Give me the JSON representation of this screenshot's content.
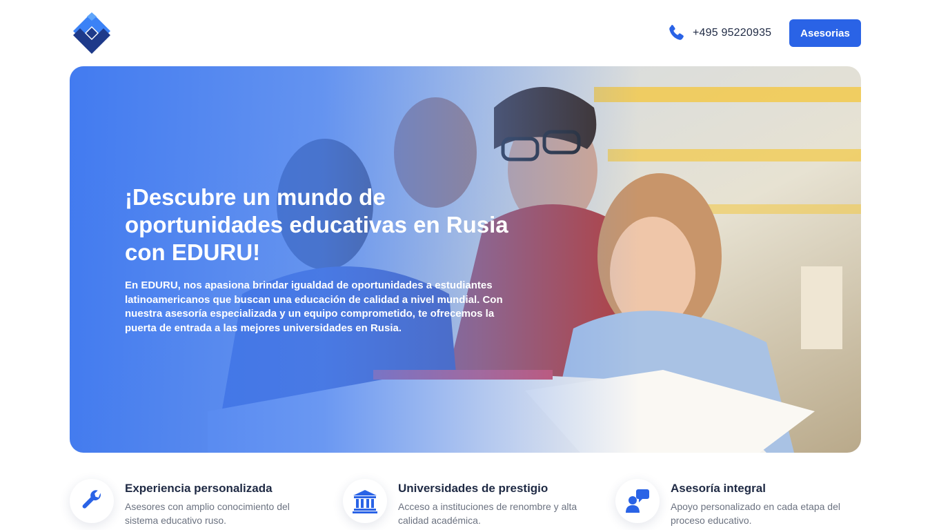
{
  "header": {
    "logo_name": "EDURU logo",
    "phone_number": "+495 95220935",
    "cta_label": "Asesorias"
  },
  "hero": {
    "title": "¡Descubre un mundo de oportunidades educativas en Rusia con EDURU!",
    "description": "En EDURU, nos apasiona brindar igualdad de oportunidades a estudiantes latinoamericanos que buscan una educación de calidad a nivel mundial. Con nuestra asesoría especializada y un equipo comprometido, te ofrecemos la puerta de entrada a las mejores universidades en Rusia."
  },
  "features": [
    {
      "icon": "wrench-icon",
      "title": "Experiencia personalizada",
      "description": "Asesores con amplio conocimiento del sistema educativo ruso."
    },
    {
      "icon": "university-icon",
      "title": "Universidades de prestigio",
      "description": "Acceso a instituciones de renombre y alta calidad académica."
    },
    {
      "icon": "consultation-icon",
      "title": "Asesoría integral",
      "description": "Apoyo personalizado en cada etapa del proceso educativo."
    }
  ],
  "colors": {
    "accent": "#2a63e6",
    "logo_light": "#3b82f6",
    "logo_dark": "#1e3a8a",
    "text_dark": "#1f2a44",
    "text_muted": "#6b7280"
  }
}
